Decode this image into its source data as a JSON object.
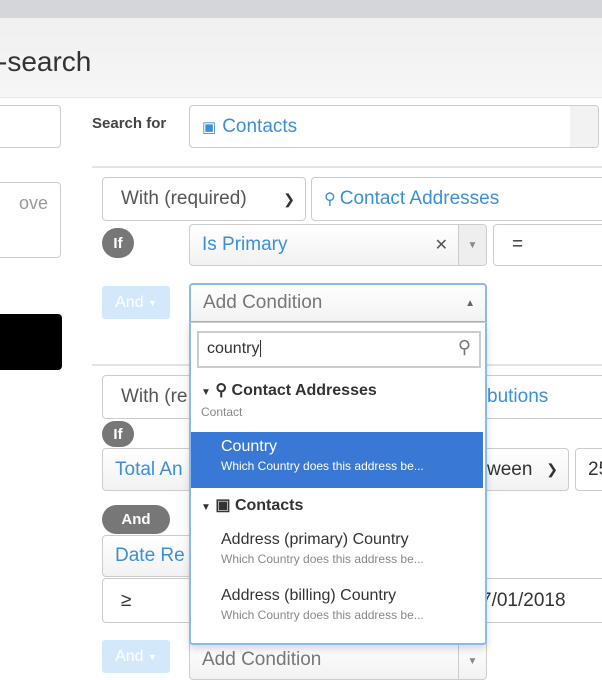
{
  "page": {
    "title": "-search"
  },
  "left": {
    "textarea_placeholder": "ove"
  },
  "search_for": {
    "label": "Search for",
    "value": "Contacts"
  },
  "group1": {
    "join": "With (required)",
    "entity": "Contact Addresses",
    "if_badge": "If",
    "field": "Is Primary",
    "operator": "=",
    "and_button": "And",
    "add_condition": "Add Condition"
  },
  "dropdown": {
    "search_value": "country",
    "groups": [
      {
        "label": "Contact Addresses",
        "sublabel": "Contact",
        "icon": "map-marker-icon",
        "items": [
          {
            "label": "Country",
            "description": "Which Country does this address be...",
            "selected": true
          }
        ]
      },
      {
        "label": "Contacts",
        "icon": "contact-card-icon",
        "items": [
          {
            "label": "Address (primary) Country",
            "description": "Which Country does this address be..."
          },
          {
            "label": "Address (billing) Country",
            "description": "Which Country does this address be..."
          }
        ]
      }
    ]
  },
  "group2": {
    "join": "With (re",
    "entity": "butions",
    "if_badge": "If",
    "field": "Total An",
    "operator": "ween",
    "value": "25",
    "and_badge": "And",
    "field2": "Date Re",
    "operator2": "≥",
    "date": "7/01/2018",
    "and_button": "And",
    "add_condition": "Add Condition"
  },
  "colors": {
    "accent": "#3b8fd8",
    "highlight": "#3a78d6"
  }
}
